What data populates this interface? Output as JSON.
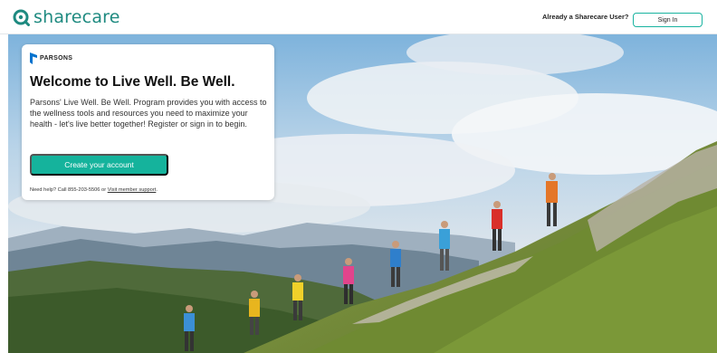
{
  "header": {
    "logo_text": "sharecare",
    "logo_icon": "sharecare-search-icon",
    "already_user_text": "Already a Sharecare User?",
    "signin_label": "Sign In"
  },
  "card": {
    "brand_name": "PARSONS",
    "title": "Welcome to Live Well. Be Well.",
    "description": "Parsons' Live Well. Be Well. Program provides you with access to the wellness tools and resources you need to maximize your health - let's live better together! Register or sign in to begin.",
    "cta_label": "Create your account",
    "help_prefix": "Need help? Call 855-203-5506 or ",
    "help_link": "Visit member support",
    "help_suffix": "."
  },
  "colors": {
    "brand_teal": "#1e8a80",
    "accent": "#15b39c",
    "parsons_blue": "#0072ce"
  }
}
